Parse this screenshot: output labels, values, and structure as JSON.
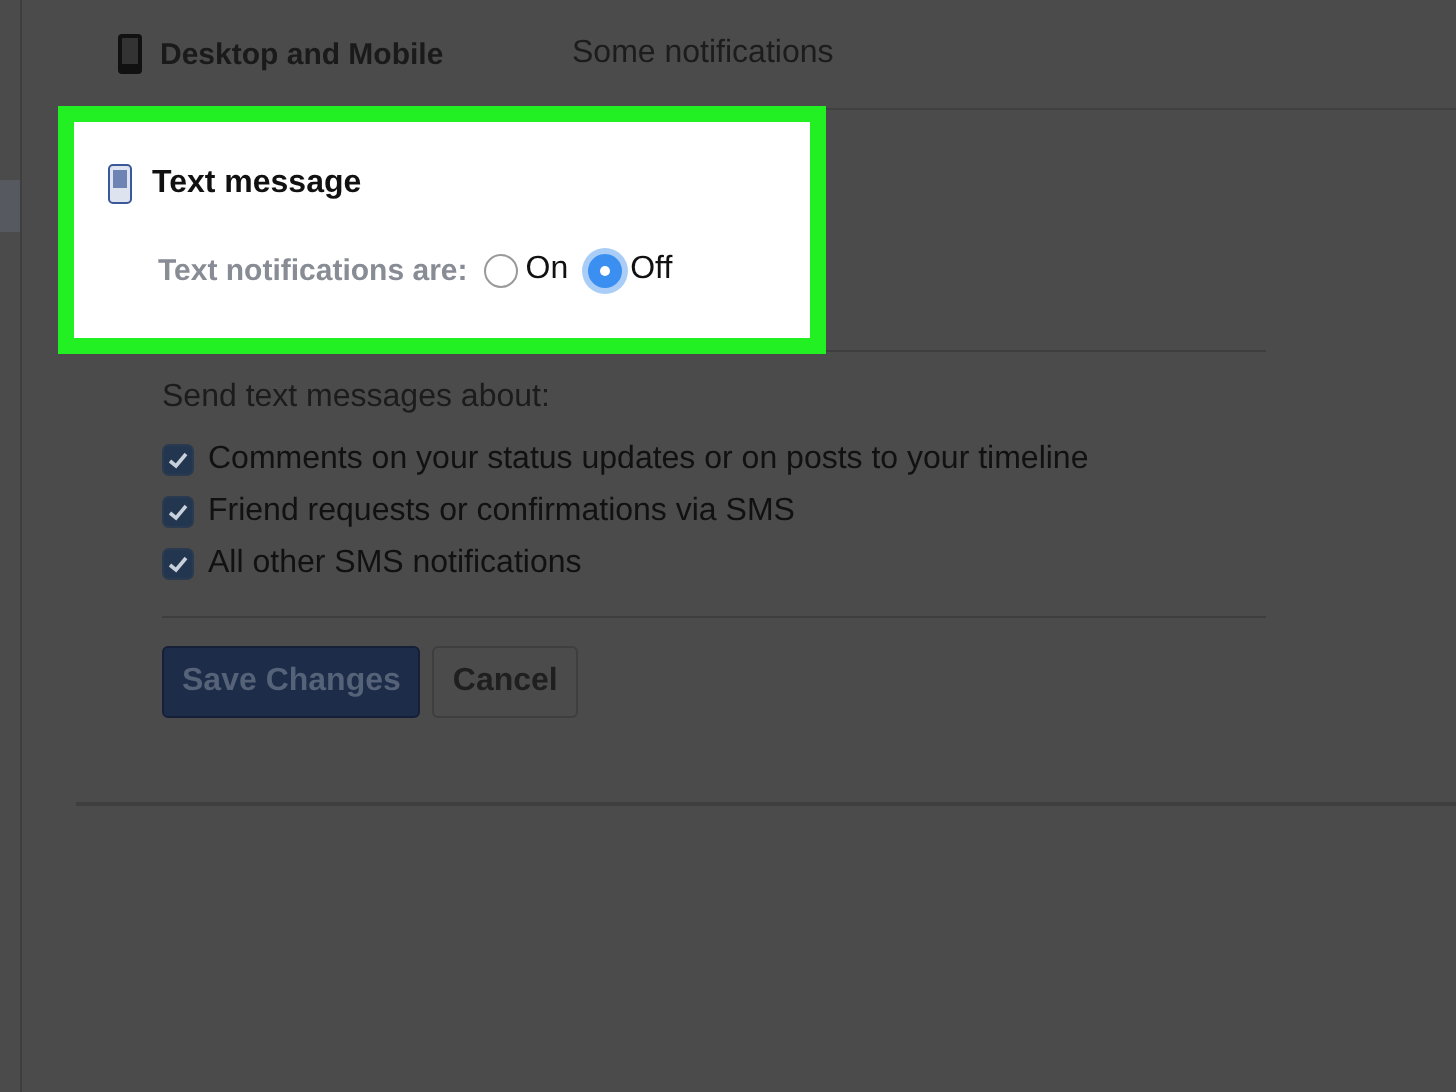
{
  "setting_row": {
    "title": "Desktop and Mobile",
    "value": "Some notifications"
  },
  "text_message": {
    "title": "Text message",
    "label": "Text notifications are:",
    "options": [
      {
        "label": "On",
        "selected": false
      },
      {
        "label": "Off",
        "selected": true
      }
    ]
  },
  "send_about": {
    "label": "Send text messages about:",
    "items": [
      {
        "label": "Comments on your status updates or on posts to your timeline",
        "checked": true
      },
      {
        "label": "Friend requests or confirmations via SMS",
        "checked": true
      },
      {
        "label": "All other SMS notifications",
        "checked": true
      }
    ]
  },
  "buttons": [
    {
      "label": "Save Changes",
      "kind": "primary"
    },
    {
      "label": "Cancel",
      "kind": "default"
    }
  ]
}
